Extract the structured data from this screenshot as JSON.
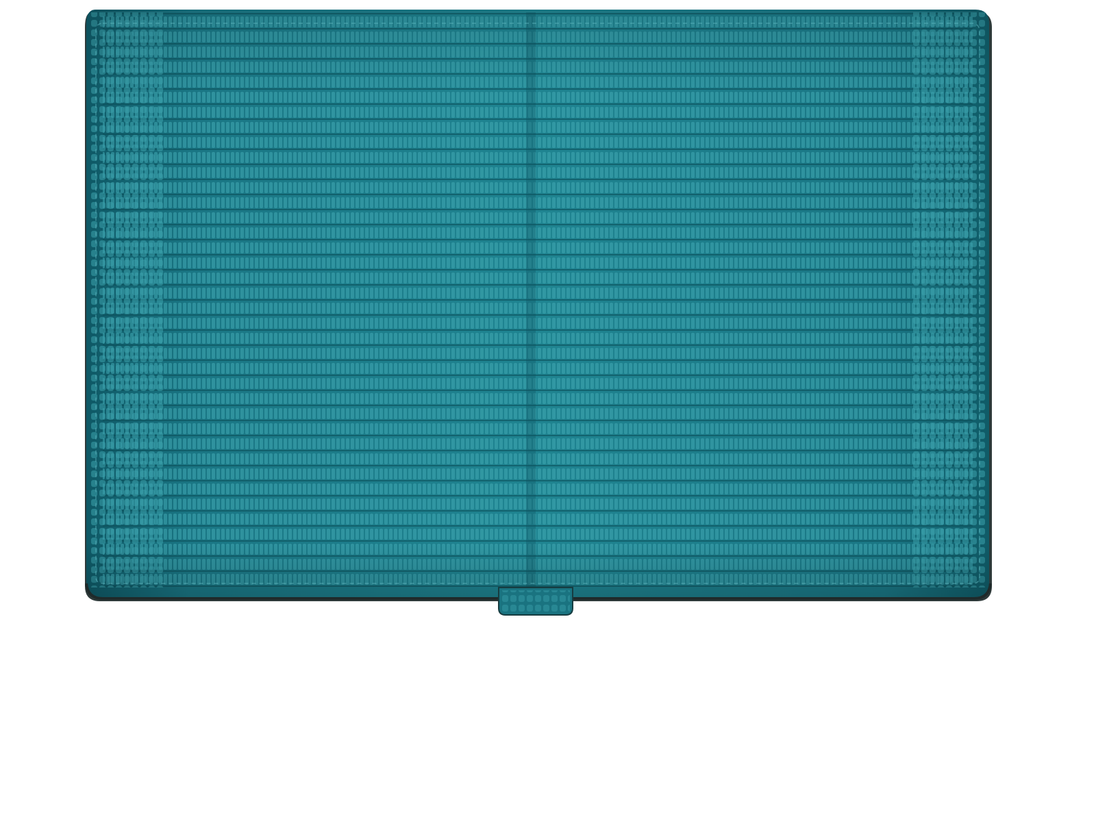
{
  "image": {
    "subject": "wallet",
    "background_color": "#ffffff",
    "colors": {
      "leather": "#1c7f8c",
      "leather_dark": "#0f5d69",
      "leather_highlight": "#3aa3ad",
      "edge": "#2f3f3f",
      "tab": "#1a7380"
    }
  }
}
